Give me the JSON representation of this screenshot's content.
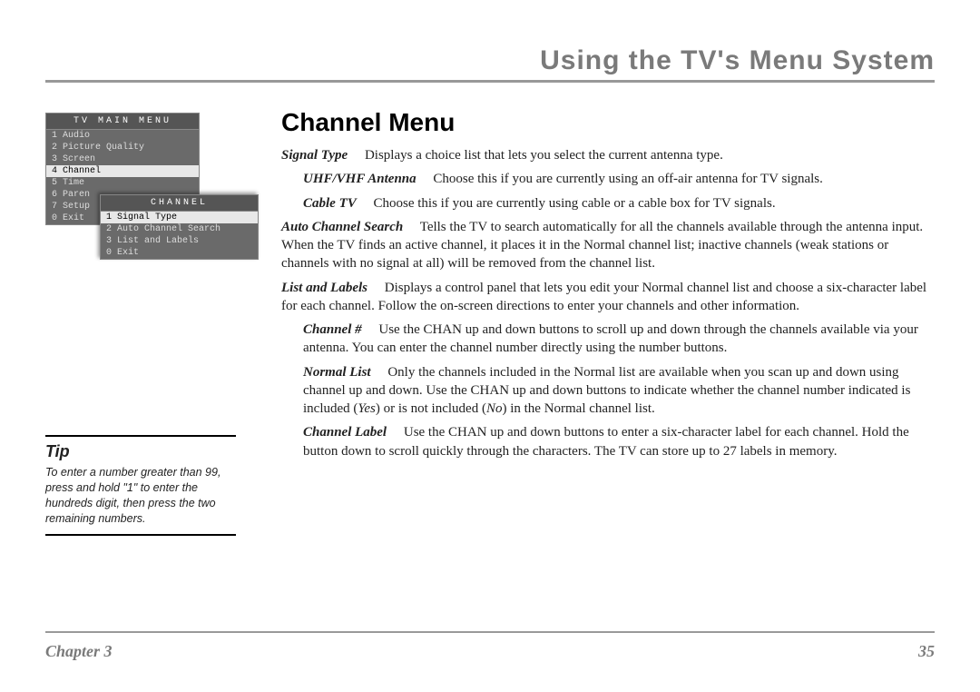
{
  "header": {
    "title": "Using the TV's Menu System"
  },
  "section": {
    "heading": "Channel Menu"
  },
  "body": {
    "signal_type_term": "Signal Type",
    "signal_type_text": "Displays a choice list that lets you select the current antenna type.",
    "uhf_term": "UHF/VHF Antenna",
    "uhf_text": "Choose this if you are currently using an off-air antenna for TV signals.",
    "cable_term": "Cable TV",
    "cable_text": "Choose this if you are currently using cable or a cable box for TV signals.",
    "auto_term": "Auto Channel Search",
    "auto_text": "Tells the TV to search automatically for all the channels available through the antenna input. When the TV finds an active channel, it places it in the Normal channel list; inactive channels (weak stations or channels with no signal at all) will be removed from the channel list.",
    "list_term": "List and Labels",
    "list_text": "Displays a control panel that lets you edit your Normal channel list and choose a six-character label for each channel. Follow the on-screen directions to enter your channels and other information.",
    "chnum_term": "Channel #",
    "chnum_text": "Use the CHAN up and down buttons to scroll up and down through the channels available via your antenna. You can enter the channel number directly using the number buttons.",
    "norm_term": "Normal List",
    "norm_text_a": "Only the channels included in the Normal list are available when you scan up and down using channel up and down. Use the CHAN up and down buttons to indicate whether the channel number indicated is included (",
    "norm_yes": "Yes",
    "norm_text_b": ") or is not included (",
    "norm_no": "No",
    "norm_text_c": ") in the Normal channel list.",
    "label_term": "Channel Label",
    "label_text": "Use the CHAN up and down buttons to enter a six-character label for each channel. Hold the button down to scroll quickly through the characters. The TV can store up to 27 labels in memory."
  },
  "tv_menu": {
    "main_title": "TV MAIN MENU",
    "main_items": [
      "1 Audio",
      "2 Picture Quality",
      "3 Screen",
      "4 Channel",
      "5 Time",
      "6 Paren",
      "7 Setup",
      "0 Exit"
    ],
    "main_hl_index": 3,
    "sub_title": "CHANNEL",
    "sub_items": [
      "1 Signal Type",
      "2 Auto Channel Search",
      "3 List and Labels",
      "0 Exit"
    ],
    "sub_hl_index": 0
  },
  "tip": {
    "title": "Tip",
    "text": "To enter a number greater than 99, press and hold \"1\" to enter the hundreds digit, then press the two remaining numbers."
  },
  "footer": {
    "chapter": "Chapter 3",
    "page": "35"
  }
}
